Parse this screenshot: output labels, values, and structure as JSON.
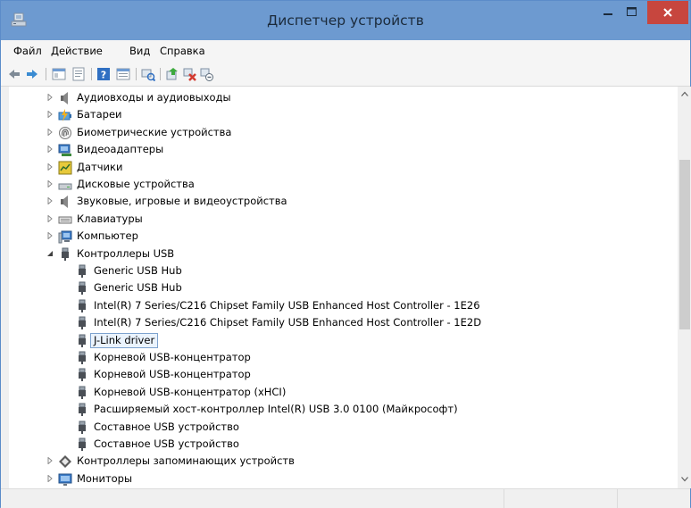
{
  "window": {
    "title": "Диспетчер устройств"
  },
  "menu": [
    "Файл",
    "Действие",
    "Вид",
    "Справка"
  ],
  "toolbar": [
    "back-icon",
    "forward-icon",
    "show-hide-tree-icon",
    "properties-icon",
    "help-icon",
    "action-list-icon",
    "scan-hardware-icon",
    "update-driver-icon",
    "uninstall-device-icon",
    "disable-device-icon"
  ],
  "tree": [
    {
      "label": "Аудиовходы и аудиовыходы",
      "icon": "speaker-icon",
      "level": 0,
      "state": "collapsed"
    },
    {
      "label": "Батареи",
      "icon": "battery-icon",
      "level": 0,
      "state": "collapsed"
    },
    {
      "label": "Биометрические устройства",
      "icon": "fingerprint-icon",
      "level": 0,
      "state": "collapsed"
    },
    {
      "label": "Видеоадаптеры",
      "icon": "display-adapter-icon",
      "level": 0,
      "state": "collapsed"
    },
    {
      "label": "Датчики",
      "icon": "sensor-icon",
      "level": 0,
      "state": "collapsed"
    },
    {
      "label": "Дисковые устройства",
      "icon": "disk-drive-icon",
      "level": 0,
      "state": "collapsed"
    },
    {
      "label": "Звуковые, игровые и видеоустройства",
      "icon": "speaker-icon",
      "level": 0,
      "state": "collapsed"
    },
    {
      "label": "Клавиатуры",
      "icon": "keyboard-icon",
      "level": 0,
      "state": "collapsed"
    },
    {
      "label": "Компьютер",
      "icon": "computer-icon",
      "level": 0,
      "state": "collapsed"
    },
    {
      "label": "Контроллеры USB",
      "icon": "usb-plug-icon",
      "level": 0,
      "state": "expanded"
    },
    {
      "label": "Generic USB Hub",
      "icon": "usb-plug-icon",
      "level": 1
    },
    {
      "label": "Generic USB Hub",
      "icon": "usb-plug-icon",
      "level": 1
    },
    {
      "label": "Intel(R) 7 Series/C216 Chipset Family USB Enhanced Host Controller - 1E26",
      "icon": "usb-plug-icon",
      "level": 1
    },
    {
      "label": "Intel(R) 7 Series/C216 Chipset Family USB Enhanced Host Controller - 1E2D",
      "icon": "usb-plug-icon",
      "level": 1
    },
    {
      "label": "J-Link driver",
      "icon": "usb-plug-icon",
      "level": 1,
      "selected": true
    },
    {
      "label": "Корневой USB-концентратор",
      "icon": "usb-plug-icon",
      "level": 1
    },
    {
      "label": "Корневой USB-концентратор",
      "icon": "usb-plug-icon",
      "level": 1
    },
    {
      "label": "Корневой USB-концентратор (xHCI)",
      "icon": "usb-plug-icon",
      "level": 1
    },
    {
      "label": "Расширяемый хост-контроллер Intel(R) USB 3.0 0100 (Майкрософт)",
      "icon": "usb-plug-icon",
      "level": 1
    },
    {
      "label": "Составное USB устройство",
      "icon": "usb-plug-icon",
      "level": 1
    },
    {
      "label": "Составное USB устройство",
      "icon": "usb-plug-icon",
      "level": 1
    },
    {
      "label": "Контроллеры запоминающих устройств",
      "icon": "storage-controller-icon",
      "level": 0,
      "state": "collapsed"
    },
    {
      "label": "Мониторы",
      "icon": "monitor-icon",
      "level": 0,
      "state": "collapsed"
    }
  ],
  "colors": {
    "titlebar": "#6d9ad0",
    "close": "#c7463e",
    "selection_border": "#7da2ce",
    "selection_fill": "#eaf3fd"
  }
}
